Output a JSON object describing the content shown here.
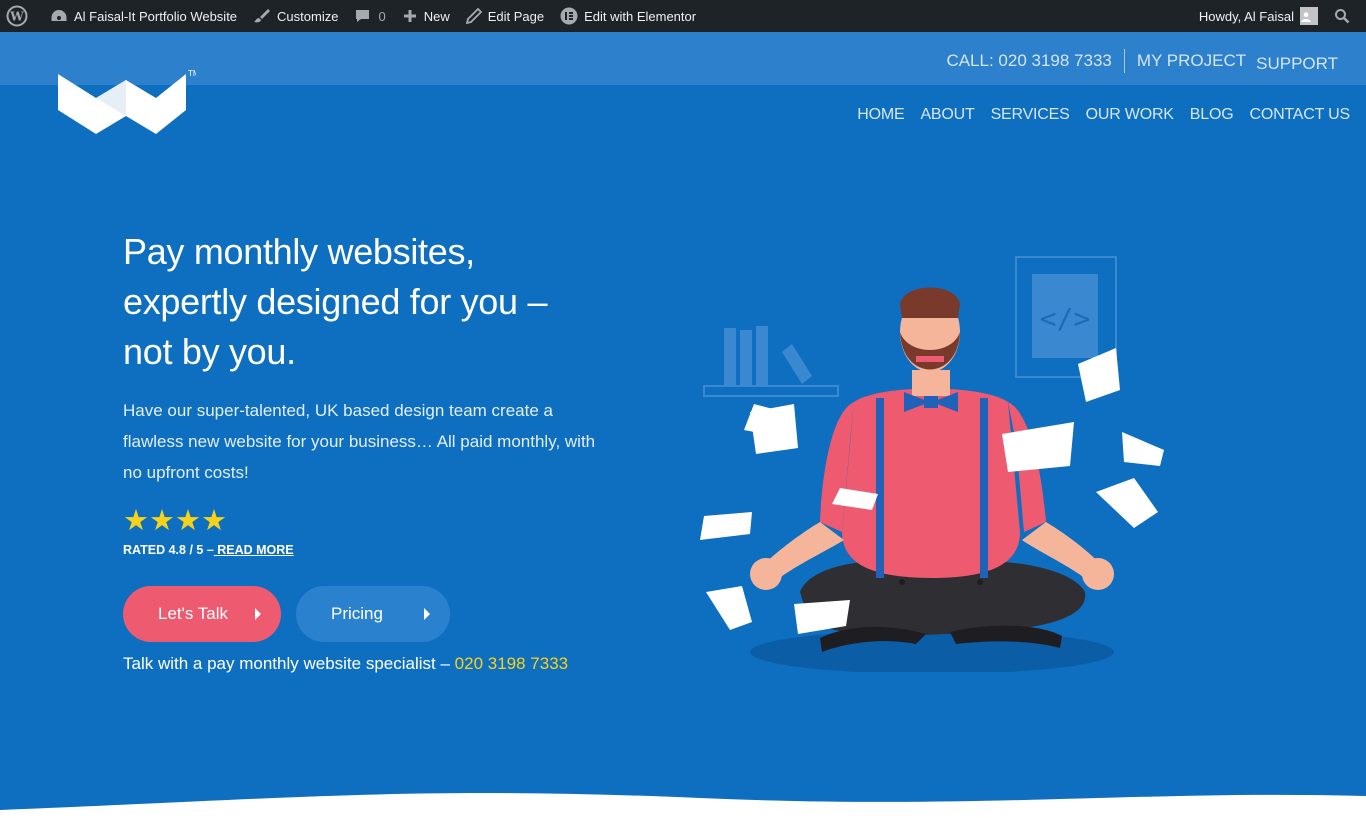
{
  "adminbar": {
    "site_name": "Al Faisal-It Portfolio Website",
    "customize": "Customize",
    "comments_count": "0",
    "new": "New",
    "edit_page": "Edit Page",
    "edit_elementor": "Edit with Elementor",
    "howdy": "Howdy, Al Faisal"
  },
  "topbar": {
    "call": "CALL: 020 3198 7333",
    "my_project": "MY PROJECT",
    "support": "SUPPORT"
  },
  "nav": {
    "items": [
      "HOME",
      "ABOUT",
      "SERVICES",
      "OUR WORK",
      "BLOG",
      "CONTACT US"
    ]
  },
  "hero": {
    "headline": [
      "Pay monthly websites,",
      "expertly designed for you –",
      "not by you."
    ],
    "lead": [
      "Have our super-talented, UK based design team create a",
      "flawless new website for your business… All paid monthly, with",
      "no upfront costs!"
    ],
    "stars": 4,
    "rating_text": "RATED 4.8 / 5 –",
    "read_more": " READ MORE",
    "btn_talk": "Let's Talk",
    "btn_pricing": "Pricing",
    "talk_text": "Talk with a pay monthly website specialist –",
    "talk_phone": " 020 3198 7333"
  },
  "colors": {
    "hero_bg": "#0e6fc0",
    "topbar_bg": "#2c80cc",
    "cta_primary": "#ee5a6f",
    "cta_secondary": "#2a82cf",
    "accent_yellow": "#f7d21b",
    "adminbar_bg": "#1d2327"
  }
}
